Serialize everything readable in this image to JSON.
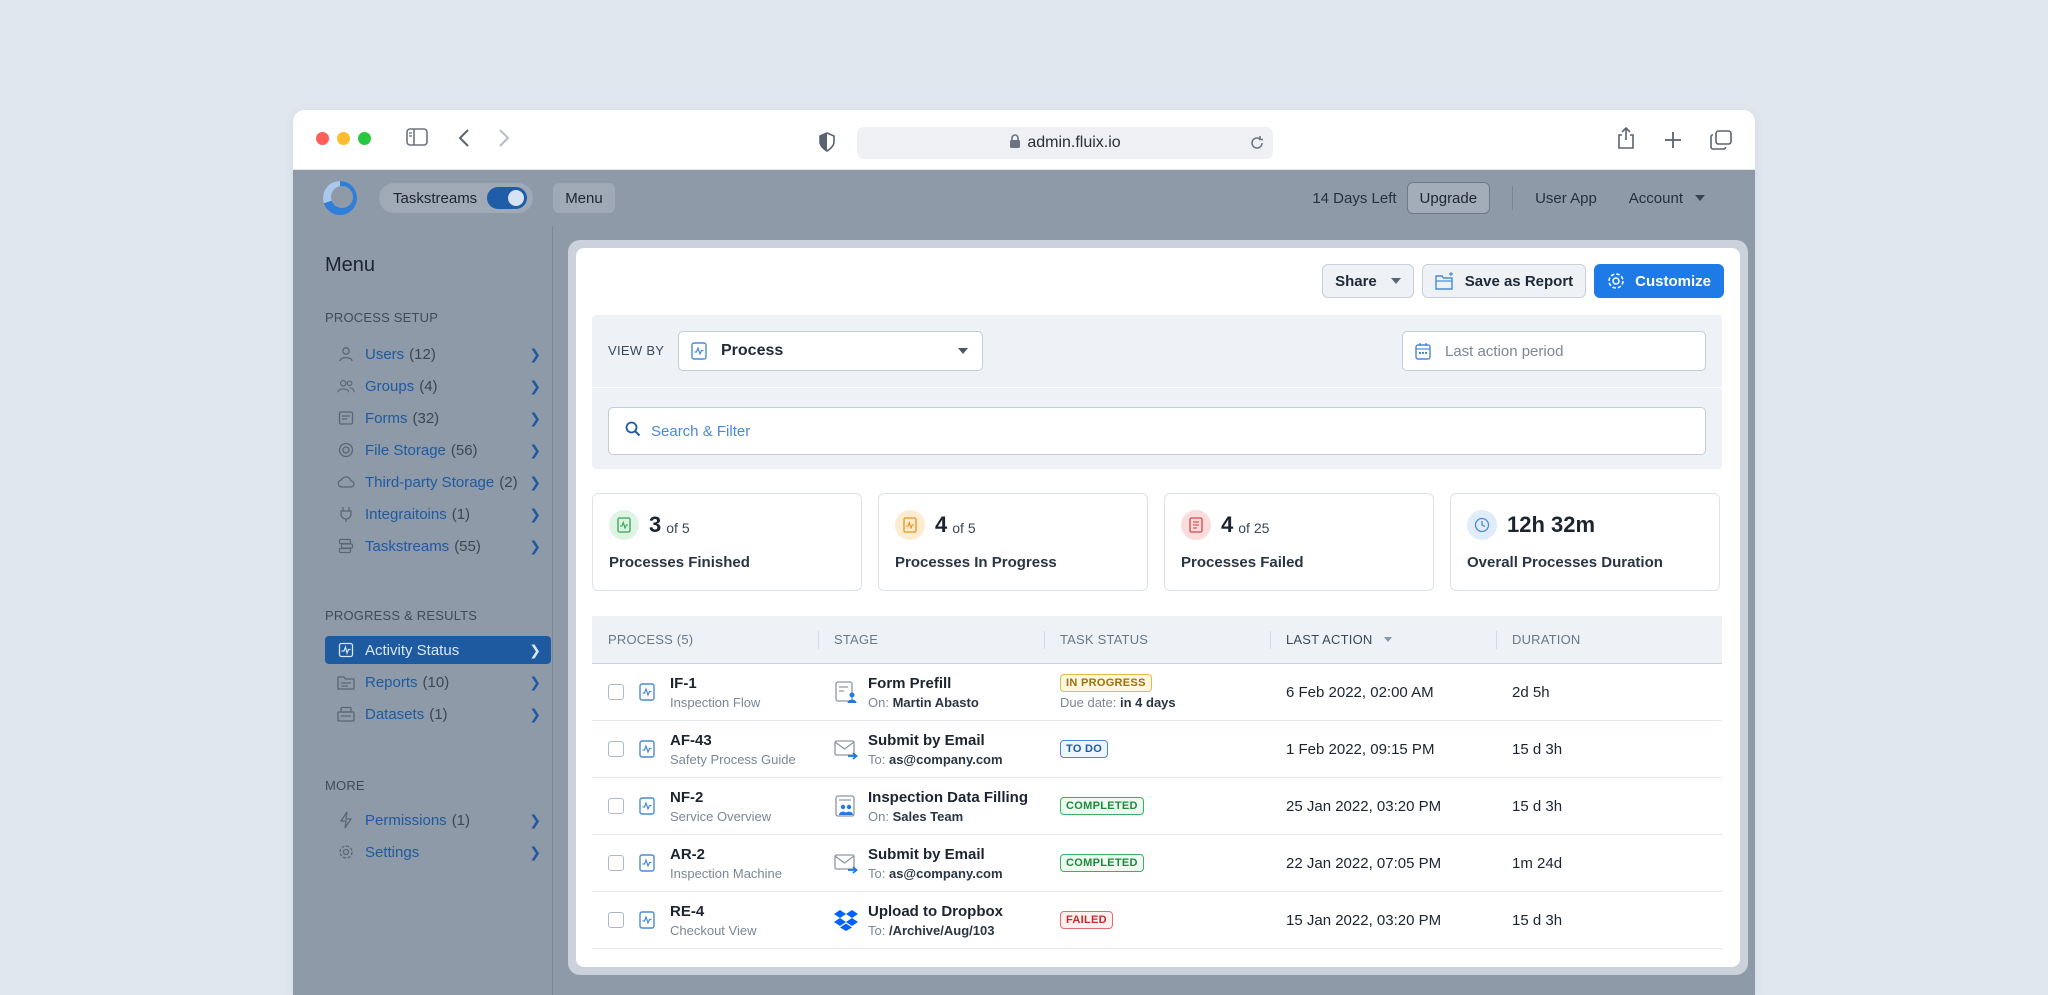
{
  "browser": {
    "url": "admin.fluix.io"
  },
  "topbar": {
    "taskstreams_label": "Taskstreams",
    "menu_label": "Menu",
    "trial_text": "14 Days Left",
    "upgrade_label": "Upgrade",
    "user_app_label": "User App",
    "account_label": "Account"
  },
  "sidebar": {
    "title": "Menu",
    "sections": [
      {
        "title": "PROCESS SETUP",
        "items": [
          {
            "label": "Users",
            "count": "(12)",
            "icon": "user-icon"
          },
          {
            "label": "Groups",
            "count": "(4)",
            "icon": "group-icon"
          },
          {
            "label": "Forms",
            "count": "(32)",
            "icon": "form-icon"
          },
          {
            "label": "File Storage",
            "count": "(56)",
            "icon": "storage-icon"
          },
          {
            "label": "Third-party Storage",
            "count": "(2)",
            "icon": "cloud-icon"
          },
          {
            "label": "Integraitoins",
            "count": "(1)",
            "icon": "plug-icon"
          },
          {
            "label": "Taskstreams",
            "count": "(55)",
            "icon": "taskstream-icon"
          }
        ]
      },
      {
        "title": "PROGRESS & RESULTS",
        "items": [
          {
            "label": "Activity Status",
            "count": "",
            "icon": "activity-icon"
          },
          {
            "label": "Reports",
            "count": "(10)",
            "icon": "report-icon"
          },
          {
            "label": "Datasets",
            "count": "(1)",
            "icon": "dataset-icon"
          }
        ]
      },
      {
        "title": "MORE",
        "items": [
          {
            "label": "Permissions",
            "count": "(1)",
            "icon": "bolt-icon"
          },
          {
            "label": "Settings",
            "count": "",
            "icon": "gear-icon"
          }
        ]
      }
    ]
  },
  "modal": {
    "share_label": "Share",
    "save_report_label": "Save as Report",
    "customize_label": "Customize",
    "view_by_label": "VIEW BY",
    "view_by_value": "Process",
    "period_placeholder": "Last action period",
    "search_placeholder": "Search & Filter",
    "stats": [
      {
        "value": "3",
        "of": "of 5",
        "label": "Processes Finished",
        "color": "#2fa84f"
      },
      {
        "value": "4",
        "of": "of 5",
        "label": "Processes In Progress",
        "color": "#e8921c"
      },
      {
        "value": "4",
        "of": "of 25",
        "label": "Processes Failed",
        "color": "#d64545"
      },
      {
        "value": "12h 32m",
        "of": "",
        "label": "Overall Processes Duration",
        "color": "#4a8ad6"
      }
    ],
    "table": {
      "headers": [
        "PROCESS (5)",
        "STAGE",
        "TASK STATUS",
        "LAST ACTION",
        "DURATION"
      ],
      "rows": [
        {
          "id": "IF-1",
          "name": "Inspection Flow",
          "stage": "Form Prefill",
          "stage_prefix": "On:",
          "stage_target": "Martin Abasto",
          "stage_icon": "form-user-icon",
          "status": "IN PROGRESS",
          "status_note_prefix": "Due date:",
          "status_note": "in 4 days",
          "last_action": "6 Feb 2022, 02:00 AM",
          "duration": "2d 5h"
        },
        {
          "id": "AF-43",
          "name": "Safety Process Guide",
          "stage": "Submit by Email",
          "stage_prefix": "To:",
          "stage_target": "as@company.com",
          "stage_icon": "email-send-icon",
          "status": "TO DO",
          "status_note_prefix": "",
          "status_note": "",
          "last_action": "1 Feb 2022, 09:15 PM",
          "duration": "15 d 3h"
        },
        {
          "id": "NF-2",
          "name": "Service Overview",
          "stage": "Inspection Data Filling",
          "stage_prefix": "On:",
          "stage_target": "Sales Team",
          "stage_icon": "form-team-icon",
          "status": "COMPLETED",
          "status_note_prefix": "",
          "status_note": "",
          "last_action": "25 Jan 2022, 03:20 PM",
          "duration": "15 d 3h"
        },
        {
          "id": "AR-2",
          "name": "Inspection Machine",
          "stage": "Submit by Email",
          "stage_prefix": "To:",
          "stage_target": "as@company.com",
          "stage_icon": "email-send-icon",
          "status": "COMPLETED",
          "status_note_prefix": "",
          "status_note": "",
          "last_action": "22 Jan 2022, 07:05 PM",
          "duration": "1m 24d"
        },
        {
          "id": "RE-4",
          "name": "Checkout View",
          "stage": "Upload to Dropbox",
          "stage_prefix": "To:",
          "stage_target": "/Archive/Aug/103",
          "stage_icon": "dropbox-icon",
          "status": "FAILED",
          "status_note_prefix": "",
          "status_note": "",
          "last_action": "15 Jan 2022, 03:20 PM",
          "duration": "15 d 3h"
        }
      ]
    }
  }
}
